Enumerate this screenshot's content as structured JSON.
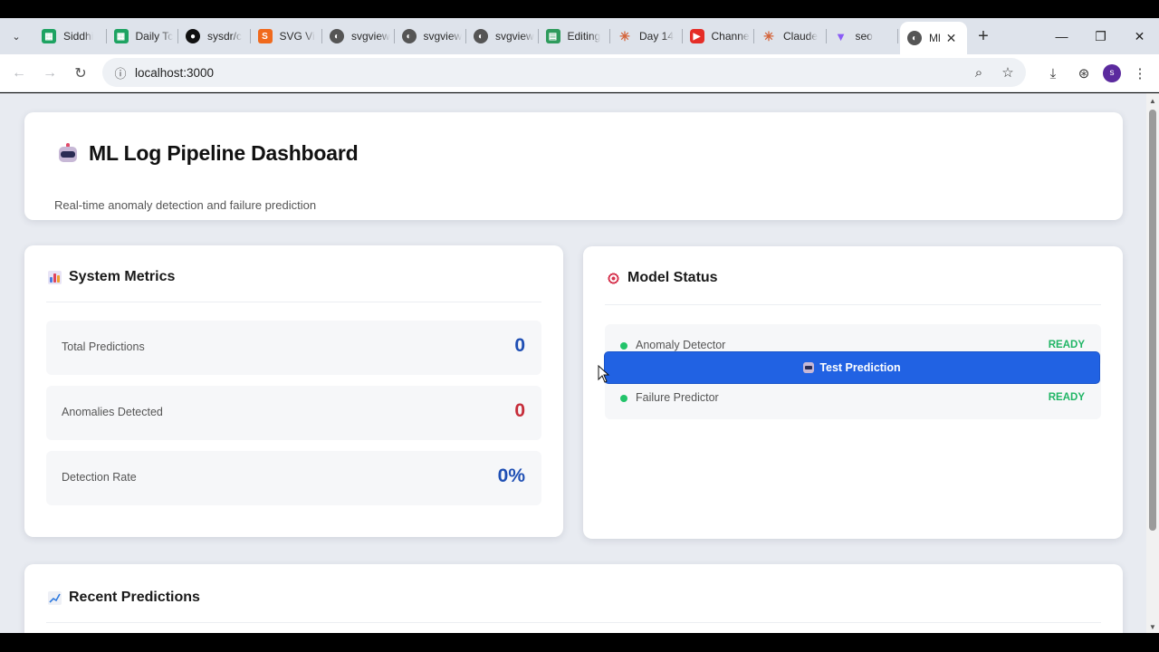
{
  "browser": {
    "tabs": [
      {
        "label": "Siddhi",
        "icon": "sheets-icon",
        "color": "#1ea362"
      },
      {
        "label": "Daily Tc",
        "icon": "sheets-icon",
        "color": "#1ea362"
      },
      {
        "label": "sysdr/c",
        "icon": "github-icon",
        "color": "#111111"
      },
      {
        "label": "SVG Vi",
        "icon": "svg-viewer-icon",
        "color": "#f06a1d"
      },
      {
        "label": "svgview",
        "icon": "globe-icon",
        "color": "#555555"
      },
      {
        "label": "svgview",
        "icon": "globe-icon",
        "color": "#555555"
      },
      {
        "label": "svgview",
        "icon": "globe-icon",
        "color": "#555555"
      },
      {
        "label": "Editing",
        "icon": "docs-icon",
        "color": "#2e9b5c"
      },
      {
        "label": "Day 14",
        "icon": "claude-icon",
        "color": "#d4643b"
      },
      {
        "label": "Channe",
        "icon": "youtube-icon",
        "color": "#e52d27"
      },
      {
        "label": "Claude",
        "icon": "claude-icon",
        "color": "#d4643b"
      },
      {
        "label": "seo",
        "icon": "vite-icon",
        "color": "#8b5cf6"
      }
    ],
    "active_tab": {
      "label": "Ml",
      "icon": "globe-icon"
    },
    "url": "localhost:3000",
    "profile_initial": "s"
  },
  "header": {
    "title": "ML Log Pipeline Dashboard",
    "subtitle": "Real-time anomaly detection and failure prediction"
  },
  "metrics": {
    "title": "System Metrics",
    "items": [
      {
        "label": "Total Predictions",
        "value": "0",
        "color": "#1f4fb4"
      },
      {
        "label": "Anomalies Detected",
        "value": "0",
        "color": "#c62d3a"
      },
      {
        "label": "Detection Rate",
        "value": "0%",
        "color": "#1f4fb4"
      }
    ]
  },
  "model_status": {
    "title": "Model Status",
    "models": [
      {
        "name": "Anomaly Detector",
        "status": "READY"
      },
      {
        "name": "Failure Predictor",
        "status": "READY"
      }
    ],
    "button_label": "Test Prediction"
  },
  "recent": {
    "title": "Recent Predictions"
  }
}
